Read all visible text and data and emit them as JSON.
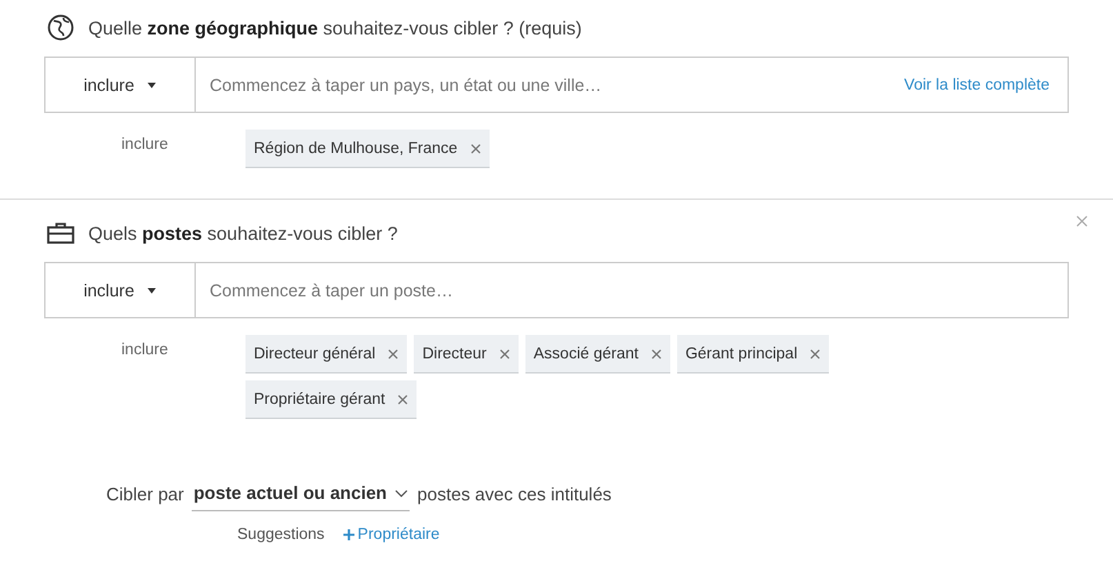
{
  "sections": [
    {
      "kind": "location",
      "heading": "Quelle **zone géographique** souhaitez-vous cibler ? (requis)",
      "mode": "inclure",
      "placeholder": "Commencez à taper un pays, un état ou une ville…",
      "link": "Voir la liste complète",
      "closable": false,
      "included_label": "inclure",
      "chips": [
        "Région de Mulhouse, France"
      ]
    },
    {
      "kind": "position",
      "heading": "Quels **postes** souhaitez-vous cibler ?",
      "mode": "inclure",
      "placeholder": "Commencez à taper un poste…",
      "closable": true,
      "included_label": "inclure",
      "chips": [
        "Directeur général",
        "Directeur",
        "Associé gérant",
        "Gérant principal",
        "Propriétaire gérant"
      ]
    }
  ],
  "target": {
    "prefix": "Cibler par",
    "value": "poste actuel ou ancien",
    "suffix": "postes avec ces intitulés"
  },
  "suggestions": {
    "label": "Suggestions",
    "items": [
      "Propriétaire"
    ]
  }
}
